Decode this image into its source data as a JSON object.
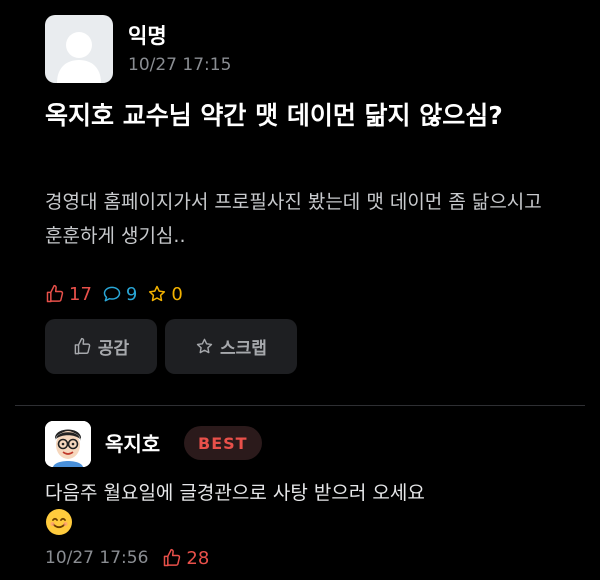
{
  "post": {
    "author": "익명",
    "time": "10/27 17:15",
    "title": "옥지호 교수님 약간 맷 데이먼 닮지 않으심?",
    "body": "경영대 홈페이지가서 프로필사진 봤는데 맷 데이먼 좀 닮으시고 훈훈하게 생기심..",
    "stats": {
      "likes": "17",
      "comments": "9",
      "scraps": "0"
    },
    "buttons": {
      "like": "공감",
      "scrap": "스크랩"
    }
  },
  "comment": {
    "author": "옥지호",
    "badge": "BEST",
    "text": "다음주 월요일에 글경관으로 사탕 받으러 오세요",
    "time": "10/27 17:56",
    "likes": "28"
  },
  "colors": {
    "background": "#000000",
    "like": "#e8504a",
    "comment": "#29a6d6",
    "scrap": "#f3b200",
    "muted": "#8a8d92"
  },
  "icons": [
    "default-avatar-icon",
    "thumbs-up-icon",
    "comment-bubble-icon",
    "star-icon",
    "smiling-emoji-icon"
  ]
}
